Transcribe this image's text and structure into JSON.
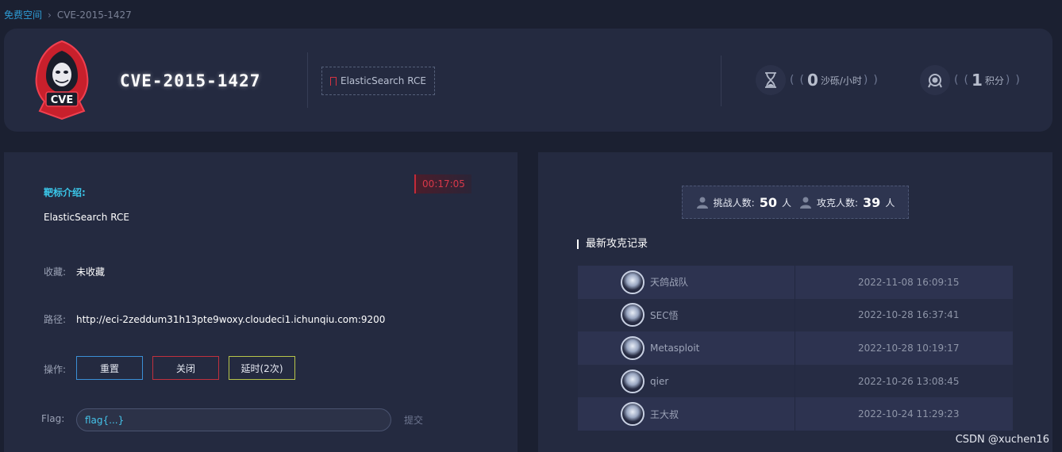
{
  "breadcrumb": {
    "home": "免费空间",
    "current": "CVE-2015-1427"
  },
  "header": {
    "logo_text": "CVE",
    "title": "CVE-2015-1427",
    "tag": "ElasticSearch RCE",
    "rate": {
      "value": "0",
      "unit": "沙砾/小时",
      "icon": "hourglass-icon"
    },
    "score": {
      "value": "1",
      "unit": "积分",
      "icon": "medal-icon"
    }
  },
  "left": {
    "timer": "00:17:05",
    "intro_label": "靶标介绍:",
    "intro_text": "ElasticSearch RCE",
    "favorite_label": "收藏:",
    "favorite_value": "未收藏",
    "path_label": "路径:",
    "path_value": "http://eci-2zeddum31h13pte9woxy.cloudeci1.ichunqiu.com:9200",
    "ops_label": "操作:",
    "btn_reset": "重置",
    "btn_close": "关闭",
    "btn_extend": "延时(2次)",
    "flag_label": "Flag:",
    "flag_placeholder": "flag{...}",
    "submit": "提交"
  },
  "right": {
    "challengers_label": "挑战人数:",
    "challengers_count": "50",
    "solvers_label": "攻克人数:",
    "solvers_count": "39",
    "person_unit": "人",
    "records_title": "最新攻克记录",
    "records": [
      {
        "name": "天鸽战队",
        "time": "2022-11-08 16:09:15"
      },
      {
        "name": "SEC悟",
        "time": "2022-10-28 16:37:41"
      },
      {
        "name": "Metasploit",
        "time": "2022-10-28 10:19:17"
      },
      {
        "name": "qier",
        "time": "2022-10-26 13:08:45"
      },
      {
        "name": "王大叔",
        "time": "2022-10-24 11:29:23"
      }
    ]
  },
  "watermark": "CSDN @xuchen16",
  "colors": {
    "accent": "#3ac6e8",
    "danger": "#d8384a",
    "panel": "#242a40",
    "background": "#1b2031"
  }
}
